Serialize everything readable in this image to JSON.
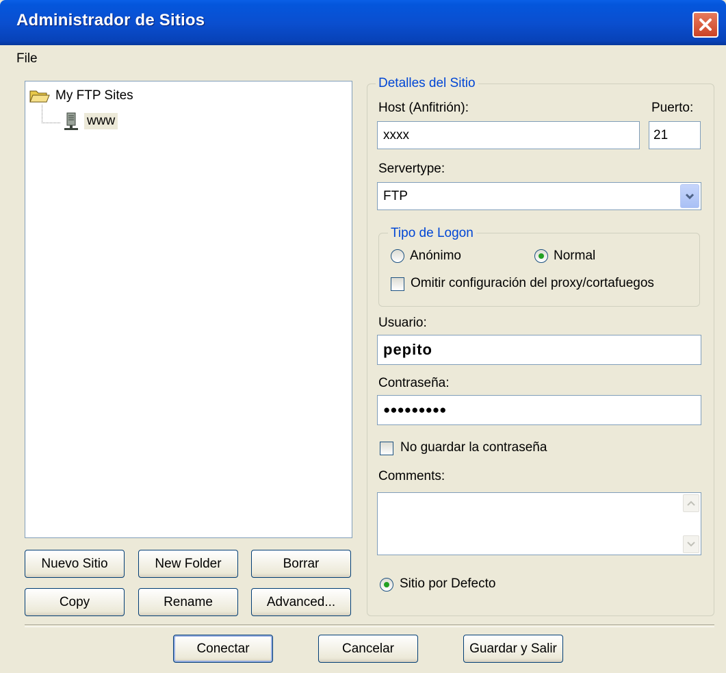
{
  "window": {
    "title": "Administrador de Sitios"
  },
  "menu": {
    "file": "File"
  },
  "tree": {
    "root_label": "My FTP Sites",
    "child_label": "www"
  },
  "left_buttons": {
    "new_site": "Nuevo Sitio",
    "new_folder": "New Folder",
    "delete": "Borrar",
    "copy": "Copy",
    "rename": "Rename",
    "advanced": "Advanced..."
  },
  "details": {
    "legend": "Detalles del Sitio",
    "host_label": "Host (Anfitrión):",
    "host_value": "xxxx",
    "port_label": "Puerto:",
    "port_value": "21",
    "servertype_label": "Servertype:",
    "servertype_value": "FTP",
    "logon": {
      "legend": "Tipo de Logon",
      "anonymous": "Anónimo",
      "normal": "Normal",
      "selected": "Normal",
      "bypass_proxy": "Omitir configuración del proxy/cortafuegos",
      "bypass_proxy_checked": false
    },
    "user_label": "Usuario:",
    "user_value": "pepito",
    "password_label": "Contraseña:",
    "password_value": "●●●●●●●●●",
    "dont_save_password": "No guardar la contraseña",
    "dont_save_password_checked": false,
    "comments_label": "Comments:",
    "comments_value": "",
    "default_site": "Sitio por Defecto",
    "default_site_selected": true
  },
  "bottom_buttons": {
    "connect": "Conectar",
    "cancel": "Cancelar",
    "save_exit": "Guardar y Salir"
  }
}
